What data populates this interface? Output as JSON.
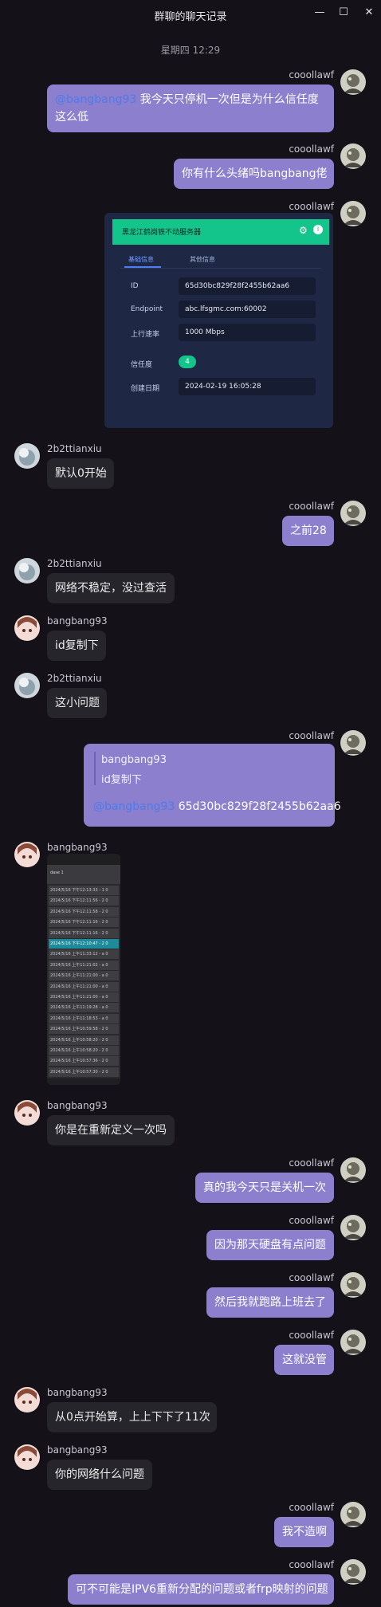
{
  "window": {
    "title": "群聊的聊天记录",
    "minimize_glyph": "—",
    "maximize_glyph": "☐",
    "close_glyph": "✕"
  },
  "date_separator": "星期四 12:29",
  "users": {
    "me": "cooollawf",
    "tian": "2b2ttianxiu",
    "bang": "bangbang93"
  },
  "messages": {
    "m1": {
      "mention": "@bangbang93",
      "text": " 我今天只停机一次但是为什么信任度这么低"
    },
    "m2": {
      "text": "你有什么头绪吗bangbang佬"
    },
    "m4": {
      "text": "默认0开始"
    },
    "m5": {
      "text": "之前28"
    },
    "m6": {
      "text": "网络不稳定，没过查活"
    },
    "m7": {
      "text": "id复制下"
    },
    "m8": {
      "text": "这小问题"
    },
    "m9": {
      "quote_nick": "bangbang93",
      "quote_text": "id复制下",
      "mention": "@bangbang93",
      "text": " 65d30bc829f28f2455b62aa6"
    },
    "m11": {
      "text": "你是在重新定义一次吗"
    },
    "m12": {
      "text": "真的我今天只是关机一次"
    },
    "m13": {
      "text": "因为那天硬盘有点问题"
    },
    "m14": {
      "text": "然后我就跑路上班去了"
    },
    "m15": {
      "text": "这就没管"
    },
    "m16": {
      "text": "从0点开始算，上上下下了11次"
    },
    "m17": {
      "text": "你的网络什么问题"
    },
    "m18": {
      "text": "我不造啊"
    },
    "m19": {
      "text": "可不可能是IPV6重新分配的问题或者frp映射的问题"
    }
  },
  "screenshot_card": {
    "header_title": "黑龙江鹤岗铁不动服务器",
    "tab_basic": "基础信息",
    "tab_other": "其他信息",
    "rows": [
      {
        "label": "ID",
        "value": "65d30bc829f28f2455b62aa6"
      },
      {
        "label": "Endpoint",
        "value": "abc.lfsgmc.com:60002"
      },
      {
        "label": "上行速率",
        "value": "1000 Mbps"
      }
    ],
    "trust_label": "信任度",
    "trust_value": "4",
    "created_label": "创建日期",
    "created_value": "2024-02-19 16:05:28",
    "accent_color": "#13c58b"
  },
  "phone_shot": {
    "header": "dase 1",
    "rows": [
      "2024/5/16 下午12:13:33 - 1 0",
      "2024/5/16 下午12:11:56 - 2 0",
      "2024/5/16 下午12:11:58 - 2 0",
      "2024/5/16 下午12:11:16 - 2 0",
      "2024/5/16 下午12:11:16 - 2 0",
      "2024/5/16 下午12:10:47 - 2 0",
      "2024/5/16 上午11:33:12 - a 0",
      "2024/5/16 上午11:21:02 - a 0",
      "2024/5/16 上午11:21:00 - a 0",
      "2024/5/16 上午11:21:00 - a 0",
      "2024/5/16 上午11:21:00 - a 0",
      "2024/5/16 上午11:19:28 - a 0",
      "2024/5/16 上午11:18:53 - a 0",
      "2024/5/16 上午10:59:58 - 2 0",
      "2024/5/16 上午10:58:20 - 2 0",
      "2024/5/16 上午10:58:20 - 2 0",
      "2024/5/16 上午10:57:36 - 2 0",
      "2024/5/16 上午10:57:30 - 2 0"
    ]
  },
  "colors": {
    "background": "#141218",
    "my_bubble": "#8b7fce",
    "their_bubble": "#26252b",
    "mention": "#4f7be9"
  }
}
